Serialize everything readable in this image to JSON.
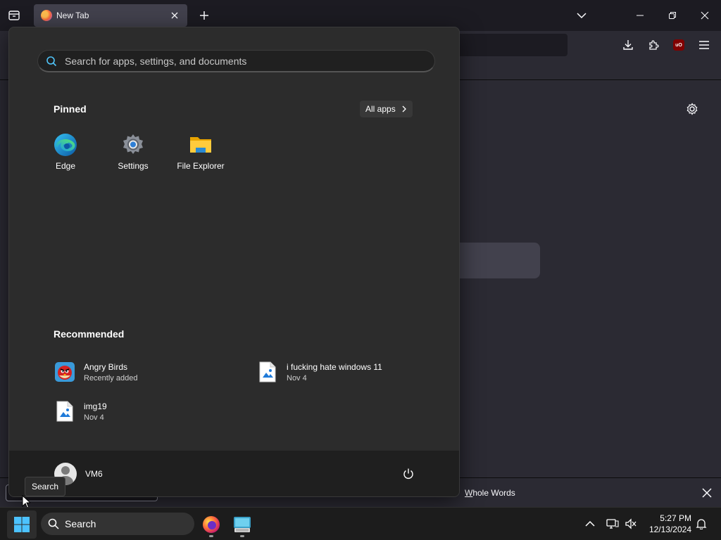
{
  "browser": {
    "tab": {
      "title": "New Tab"
    }
  },
  "findbar": {
    "whole_words_accesskey": "W",
    "whole_words_rest": "hole Words"
  },
  "start_menu": {
    "search_placeholder": "Search for apps, settings, and documents",
    "pinned_title": "Pinned",
    "all_apps_label": "All apps",
    "pinned": [
      {
        "label": "Edge",
        "icon": "edge-icon"
      },
      {
        "label": "Settings",
        "icon": "settings-gear-icon"
      },
      {
        "label": "File Explorer",
        "icon": "folder-icon"
      }
    ],
    "recommended_title": "Recommended",
    "recommended": [
      {
        "title": "Angry Birds",
        "subtitle": "Recently added",
        "icon": "angry-birds-icon"
      },
      {
        "title": "i fucking hate windows 11",
        "subtitle": "Nov 4",
        "icon": "image-file-icon"
      },
      {
        "title": "img19",
        "subtitle": "Nov 4",
        "icon": "image-file-icon"
      }
    ],
    "user_name": "VM6"
  },
  "tooltip": "Search",
  "taskbar": {
    "search_label": "Search",
    "time": "5:27 PM",
    "date": "12/13/2024"
  },
  "colors": {
    "accent": "#0078d4",
    "start_bg": "#2c2c2c",
    "taskbar_bg": "#1c1c1c"
  }
}
